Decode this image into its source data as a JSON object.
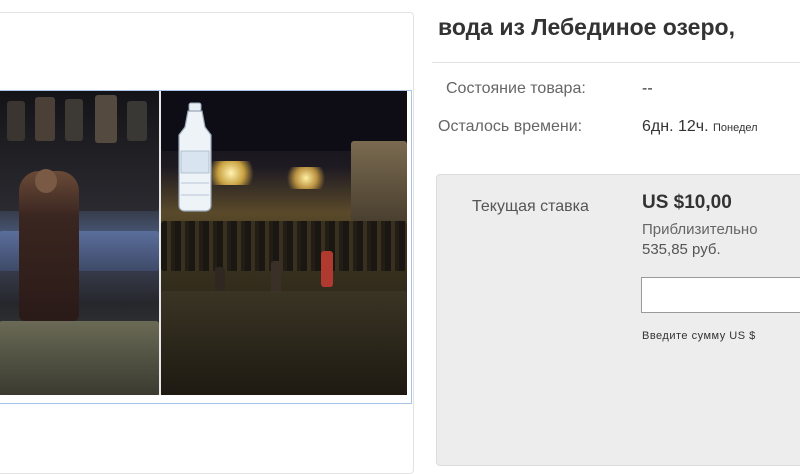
{
  "listing": {
    "title": "вода из Лебединое озеро,"
  },
  "details": {
    "condition_label": "Состояние товара:",
    "condition_value": "--",
    "time_left_label": "Осталось времени:",
    "time_left_value": "6дн. 12ч.",
    "time_left_extra": "Понедел"
  },
  "bid": {
    "current_label": "Текущая ставка",
    "price": "US $10,00",
    "approx_label": "Приблизительно",
    "approx_value": "535,85 руб.",
    "input_value": "",
    "hint": "Введите сумму US $"
  },
  "colors": {
    "accent_border": "#a9c4e6",
    "bid_panel_bg": "#ededed"
  },
  "icons": [
    "water-bottle-icon"
  ]
}
